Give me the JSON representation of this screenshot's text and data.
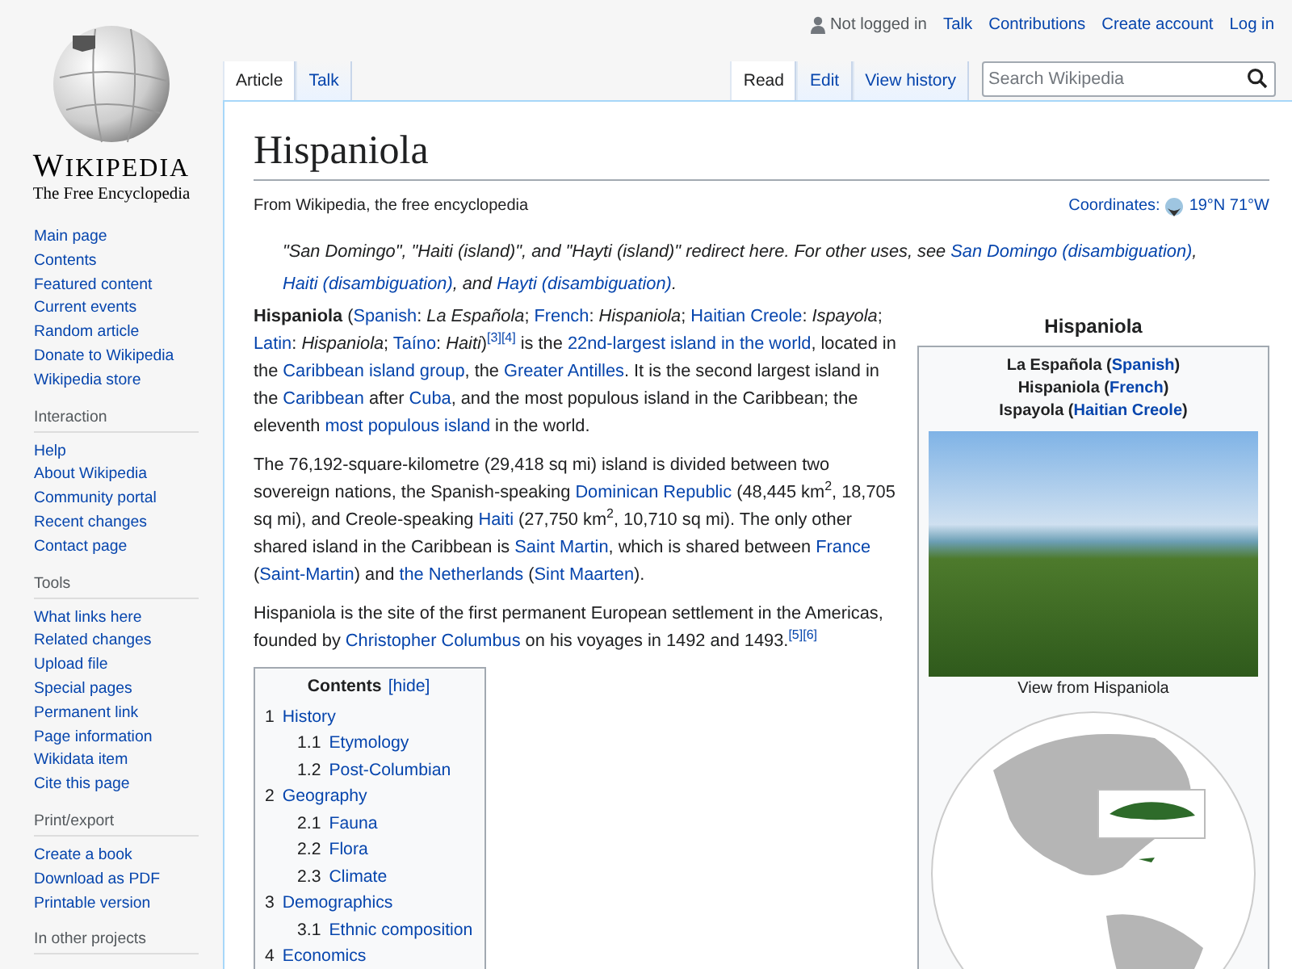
{
  "logo": {
    "wordmark": "WIKIPEDIA",
    "tagline": "The Free Encyclopedia"
  },
  "sidebar": {
    "sections": [
      {
        "items": [
          "Main page",
          "Contents",
          "Featured content",
          "Current events",
          "Random article",
          "Donate to Wikipedia",
          "Wikipedia store"
        ]
      },
      {
        "heading": "Interaction",
        "items": [
          "Help",
          "About Wikipedia",
          "Community portal",
          "Recent changes",
          "Contact page"
        ]
      },
      {
        "heading": "Tools",
        "items": [
          "What links here",
          "Related changes",
          "Upload file",
          "Special pages",
          "Permanent link",
          "Page information",
          "Wikidata item",
          "Cite this page"
        ]
      },
      {
        "heading": "Print/export",
        "items": [
          "Create a book",
          "Download as PDF",
          "Printable version"
        ]
      },
      {
        "heading": "In other projects"
      }
    ]
  },
  "personal_tools": {
    "status": "Not logged in",
    "links": [
      "Talk",
      "Contributions",
      "Create account",
      "Log in"
    ]
  },
  "namespace_tabs": [
    {
      "label": "Article",
      "selected": true
    },
    {
      "label": "Talk",
      "selected": false
    }
  ],
  "view_tabs": [
    {
      "label": "Read",
      "selected": true
    },
    {
      "label": "Edit",
      "selected": false
    },
    {
      "label": "View history",
      "selected": false
    }
  ],
  "search": {
    "placeholder": "Search Wikipedia"
  },
  "article": {
    "title": "Hispaniola",
    "tagline": "From Wikipedia, the free encyclopedia",
    "coordinates": {
      "label": "Coordinates:",
      "value": "19°N 71°W"
    },
    "hatnote": [
      {
        "kind": "text",
        "text": "\"San Domingo\", \"Haiti (island)\", and \"Hayti (island)\" redirect here. For other uses, see "
      },
      {
        "kind": "link",
        "text": "San Domingo (disambiguation)"
      },
      {
        "kind": "text",
        "text": ", "
      },
      {
        "kind": "link",
        "text": "Haiti (disambiguation)"
      },
      {
        "kind": "text",
        "text": ", and "
      },
      {
        "kind": "link",
        "text": "Hayti (disambiguation)"
      },
      {
        "kind": "text",
        "text": "."
      }
    ],
    "paragraphs": [
      [
        {
          "kind": "bold",
          "text": "Hispaniola"
        },
        {
          "kind": "text",
          "text": " ("
        },
        {
          "kind": "link",
          "text": "Spanish"
        },
        {
          "kind": "text",
          "text": ": "
        },
        {
          "kind": "italic",
          "text": "La Española"
        },
        {
          "kind": "text",
          "text": "; "
        },
        {
          "kind": "link",
          "text": "French"
        },
        {
          "kind": "text",
          "text": ": "
        },
        {
          "kind": "italic",
          "text": "Hispaniola"
        },
        {
          "kind": "text",
          "text": "; "
        },
        {
          "kind": "link",
          "text": "Haitian Creole"
        },
        {
          "kind": "text",
          "text": ": "
        },
        {
          "kind": "italic",
          "text": "Ispayola"
        },
        {
          "kind": "text",
          "text": "; "
        },
        {
          "kind": "link",
          "text": "Latin"
        },
        {
          "kind": "text",
          "text": ": "
        },
        {
          "kind": "italic",
          "text": "Hispaniola"
        },
        {
          "kind": "text",
          "text": "; "
        },
        {
          "kind": "link",
          "text": "Taíno"
        },
        {
          "kind": "text",
          "text": ": "
        },
        {
          "kind": "italic",
          "text": "Haiti"
        },
        {
          "kind": "text",
          "text": ")"
        },
        {
          "kind": "ref",
          "text": "[3]"
        },
        {
          "kind": "ref",
          "text": "[4]"
        },
        {
          "kind": "text",
          "text": " is the "
        },
        {
          "kind": "link",
          "text": "22nd-largest island in the world"
        },
        {
          "kind": "text",
          "text": ", located in the "
        },
        {
          "kind": "link",
          "text": "Caribbean island group"
        },
        {
          "kind": "text",
          "text": ", the "
        },
        {
          "kind": "link",
          "text": "Greater Antilles"
        },
        {
          "kind": "text",
          "text": ". It is the second largest island in the "
        },
        {
          "kind": "link",
          "text": "Caribbean"
        },
        {
          "kind": "text",
          "text": " after "
        },
        {
          "kind": "link",
          "text": "Cuba"
        },
        {
          "kind": "text",
          "text": ", and the most populous island in the Caribbean; the eleventh "
        },
        {
          "kind": "link",
          "text": "most populous island"
        },
        {
          "kind": "text",
          "text": " in the world."
        }
      ],
      [
        {
          "kind": "text",
          "text": "The 76,192-square-kilometre (29,418 sq mi) island is divided between two sovereign nations, the Spanish-speaking "
        },
        {
          "kind": "link",
          "text": "Dominican Republic"
        },
        {
          "kind": "text",
          "text": " (48,445 km$^{2}$, 18,705 sq mi), and Creole-speaking "
        },
        {
          "kind": "link",
          "text": "Haiti"
        },
        {
          "kind": "text",
          "text": " (27,750 km$^{2}$, 10,710 sq mi). The only other shared island in the Caribbean is "
        },
        {
          "kind": "link",
          "text": "Saint Martin"
        },
        {
          "kind": "text",
          "text": ", which is shared between "
        },
        {
          "kind": "link",
          "text": "France"
        },
        {
          "kind": "text",
          "text": " ("
        },
        {
          "kind": "link",
          "text": "Saint-Martin"
        },
        {
          "kind": "text",
          "text": ") and "
        },
        {
          "kind": "link",
          "text": "the Netherlands"
        },
        {
          "kind": "text",
          "text": " ("
        },
        {
          "kind": "link",
          "text": "Sint Maarten"
        },
        {
          "kind": "text",
          "text": ")."
        }
      ],
      [
        {
          "kind": "text",
          "text": "Hispaniola is the site of the first permanent European settlement in the Americas, founded by "
        },
        {
          "kind": "link",
          "text": "Christopher Columbus"
        },
        {
          "kind": "text",
          "text": " on his voyages in 1492 and 1493."
        },
        {
          "kind": "ref",
          "text": "[5]"
        },
        {
          "kind": "ref",
          "text": "[6]"
        }
      ]
    ],
    "toc": {
      "title": "Contents",
      "toggle": "[hide]",
      "items": [
        {
          "number": "1",
          "label": "History",
          "children": [
            {
              "number": "1.1",
              "label": "Etymology"
            },
            {
              "number": "1.2",
              "label": "Post-Columbian"
            }
          ]
        },
        {
          "number": "2",
          "label": "Geography",
          "children": [
            {
              "number": "2.1",
              "label": "Fauna"
            },
            {
              "number": "2.2",
              "label": "Flora"
            },
            {
              "number": "2.3",
              "label": "Climate"
            }
          ]
        },
        {
          "number": "3",
          "label": "Demographics",
          "children": [
            {
              "number": "3.1",
              "label": "Ethnic composition"
            }
          ]
        },
        {
          "number": "4",
          "label": "Economics"
        }
      ]
    }
  },
  "infobox": {
    "title": "Hispaniola",
    "names": [
      [
        {
          "kind": "text",
          "text": "La Española ("
        },
        {
          "kind": "link",
          "text": "Spanish"
        },
        {
          "kind": "text",
          "text": ")"
        }
      ],
      [
        {
          "kind": "text",
          "text": "Hispaniola ("
        },
        {
          "kind": "link",
          "text": "French"
        },
        {
          "kind": "text",
          "text": ")"
        }
      ],
      [
        {
          "kind": "text",
          "text": "Ispayola ("
        },
        {
          "kind": "link",
          "text": "Haitian Creole"
        },
        {
          "kind": "text",
          "text": ")"
        }
      ]
    ],
    "photo_caption": "View from Hispaniola"
  }
}
